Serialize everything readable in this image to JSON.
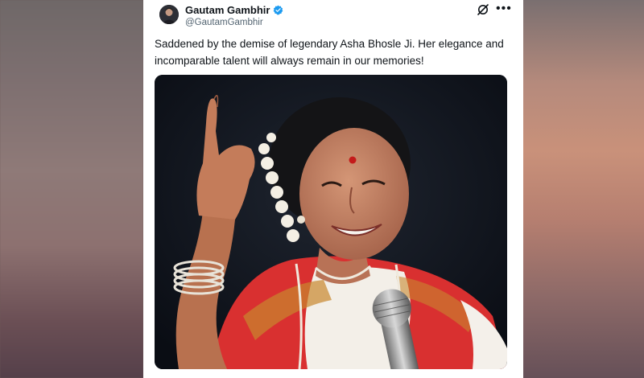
{
  "tweet": {
    "author": {
      "display_name": "Gautam Gambhir",
      "handle": "@GautamGambhir",
      "verified": true
    },
    "text": "Saddened by the demise of legendary Asha Bhosle Ji. Her elegance and incomparable talent will always remain in our memories!",
    "media": {
      "icon": "photo-of-singer"
    },
    "actions": {
      "grok_icon": "grok-icon",
      "more_icon": "more-icon"
    }
  },
  "colors": {
    "verified_blue": "#1d9bf0",
    "text_primary": "#0f1419",
    "text_secondary": "#536471"
  }
}
